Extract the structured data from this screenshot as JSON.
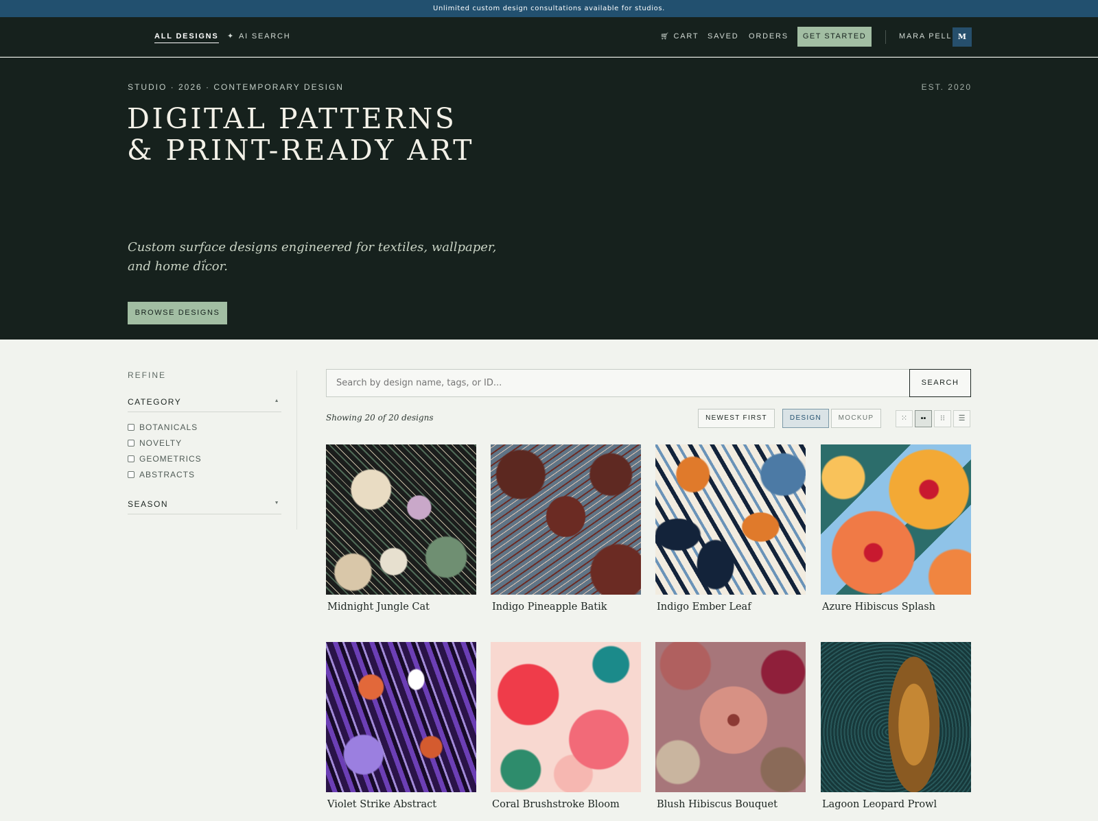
{
  "banner": {
    "text": "Unlimited custom design consultations available for studios."
  },
  "nav": {
    "left": [
      {
        "label": "ALL DESIGNS"
      },
      {
        "label": "AI SEARCH"
      }
    ],
    "right": {
      "cart": "CART",
      "saved": "SAVED",
      "orders": "ORDERS",
      "cta": "GET STARTED",
      "user": "MARA PELL",
      "avatar": "M"
    }
  },
  "hero": {
    "eyebrow": "STUDIO · 2026 · CONTEMPORARY DESIGN",
    "est": "EST. 2020",
    "title": "DIGITAL PATTERNS & PRINT-READY ART",
    "subtitle": "Custom surface designs engineered for textiles, wallpaper, and home dḯcor.",
    "cta": "BROWSE DESIGNS"
  },
  "sidebar": {
    "refine": "REFINE",
    "category": {
      "label": "CATEGORY",
      "options": [
        "BOTANICALS",
        "NOVELTY",
        "GEOMETRICS",
        "ABSTRACTS"
      ]
    },
    "season": {
      "label": "SEASON"
    }
  },
  "search": {
    "placeholder": "Search by design name, tags, or ID...",
    "button": "SEARCH"
  },
  "results": {
    "showing": "Showing 20 of 20 designs",
    "sort": "NEWEST FIRST",
    "view_modes": [
      "DESIGN",
      "MOCKUP"
    ],
    "selected_view": "DESIGN",
    "grid_icons": [
      "grid-small-icon",
      "grid-large-icon",
      "grid-dots-icon",
      "list-icon"
    ],
    "selected_grid": "grid-large-icon"
  },
  "designs": [
    {
      "title": "Midnight Jungle Cat"
    },
    {
      "title": "Indigo Pineapple Batik"
    },
    {
      "title": "Indigo Ember Leaf"
    },
    {
      "title": "Azure Hibiscus Splash"
    },
    {
      "title": "Violet Strike Abstract"
    },
    {
      "title": "Coral Brushstroke Bloom"
    },
    {
      "title": "Blush Hibiscus Bouquet"
    },
    {
      "title": "Lagoon Leopard Prowl"
    }
  ],
  "colors": {
    "accent": "#22506f",
    "dark": "#16211d",
    "sage": "#a2bea3",
    "background": "#f1f3ee"
  }
}
